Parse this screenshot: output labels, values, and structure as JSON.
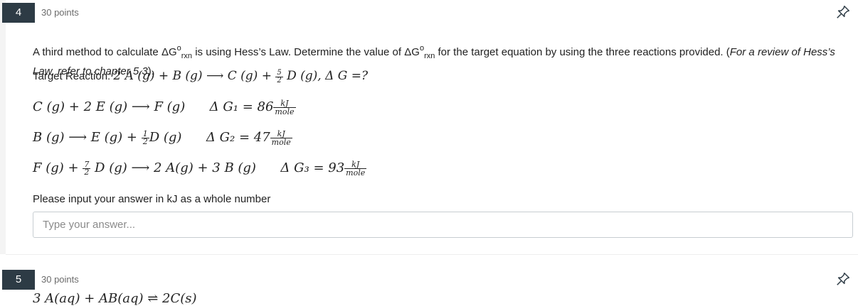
{
  "q4": {
    "number": "4",
    "points": "30 points",
    "intro_a": "A third method to calculate ΔG",
    "sup_o": "o",
    "sub_rxn": "rxn",
    "intro_b": " is using Hess’s Law. Determine the value of ΔG",
    "intro_c": " for the target equation by using the three reactions provided.  (",
    "intro_italic": "For a review of Hess’s Law, refer to chapter 5.3",
    "intro_end": ").",
    "target_label": "Target Reaction: ",
    "target_eq_a": "2 A (g) + B (g) ⟶ C (g) + ",
    "target_frac_num": "5",
    "target_frac_den": "2",
    "target_eq_b": " D (g), Δ G =?",
    "reactions": [
      {
        "eq": "C (g) + 2 E (g)  ⟶ F (g)",
        "dg": "Δ G₁ = 86",
        "unit_num": "kJ",
        "unit_den": "mole"
      },
      {
        "eq_a": "B (g)  ⟶ E (g) + ",
        "frac_num": "1",
        "frac_den": "2",
        "eq_b": "D (g)",
        "dg": "Δ G₂ = 47",
        "unit_num": "kJ",
        "unit_den": "mole"
      },
      {
        "eq_a": "F (g) + ",
        "frac_num": "7",
        "frac_den": "2",
        "eq_b": " D (g) ⟶ 2 A(g) + 3 B (g)",
        "dg": "Δ G₃ = 93",
        "unit_num": "kJ",
        "unit_den": "mole"
      }
    ],
    "prompt": "Please input your answer in kJ as a whole number",
    "answer_placeholder": "Type your answer...",
    "answer_value": ""
  },
  "q5": {
    "number": "5",
    "points": "30 points",
    "text": "3 A(aq) + AB(aq) ⇌ 2C(s)"
  },
  "colors": {
    "number_badge": "#2d3b45",
    "points_text": "#6b6b6b",
    "input_border": "#c7cdd1"
  },
  "icons": {
    "pin": "pin-icon"
  }
}
